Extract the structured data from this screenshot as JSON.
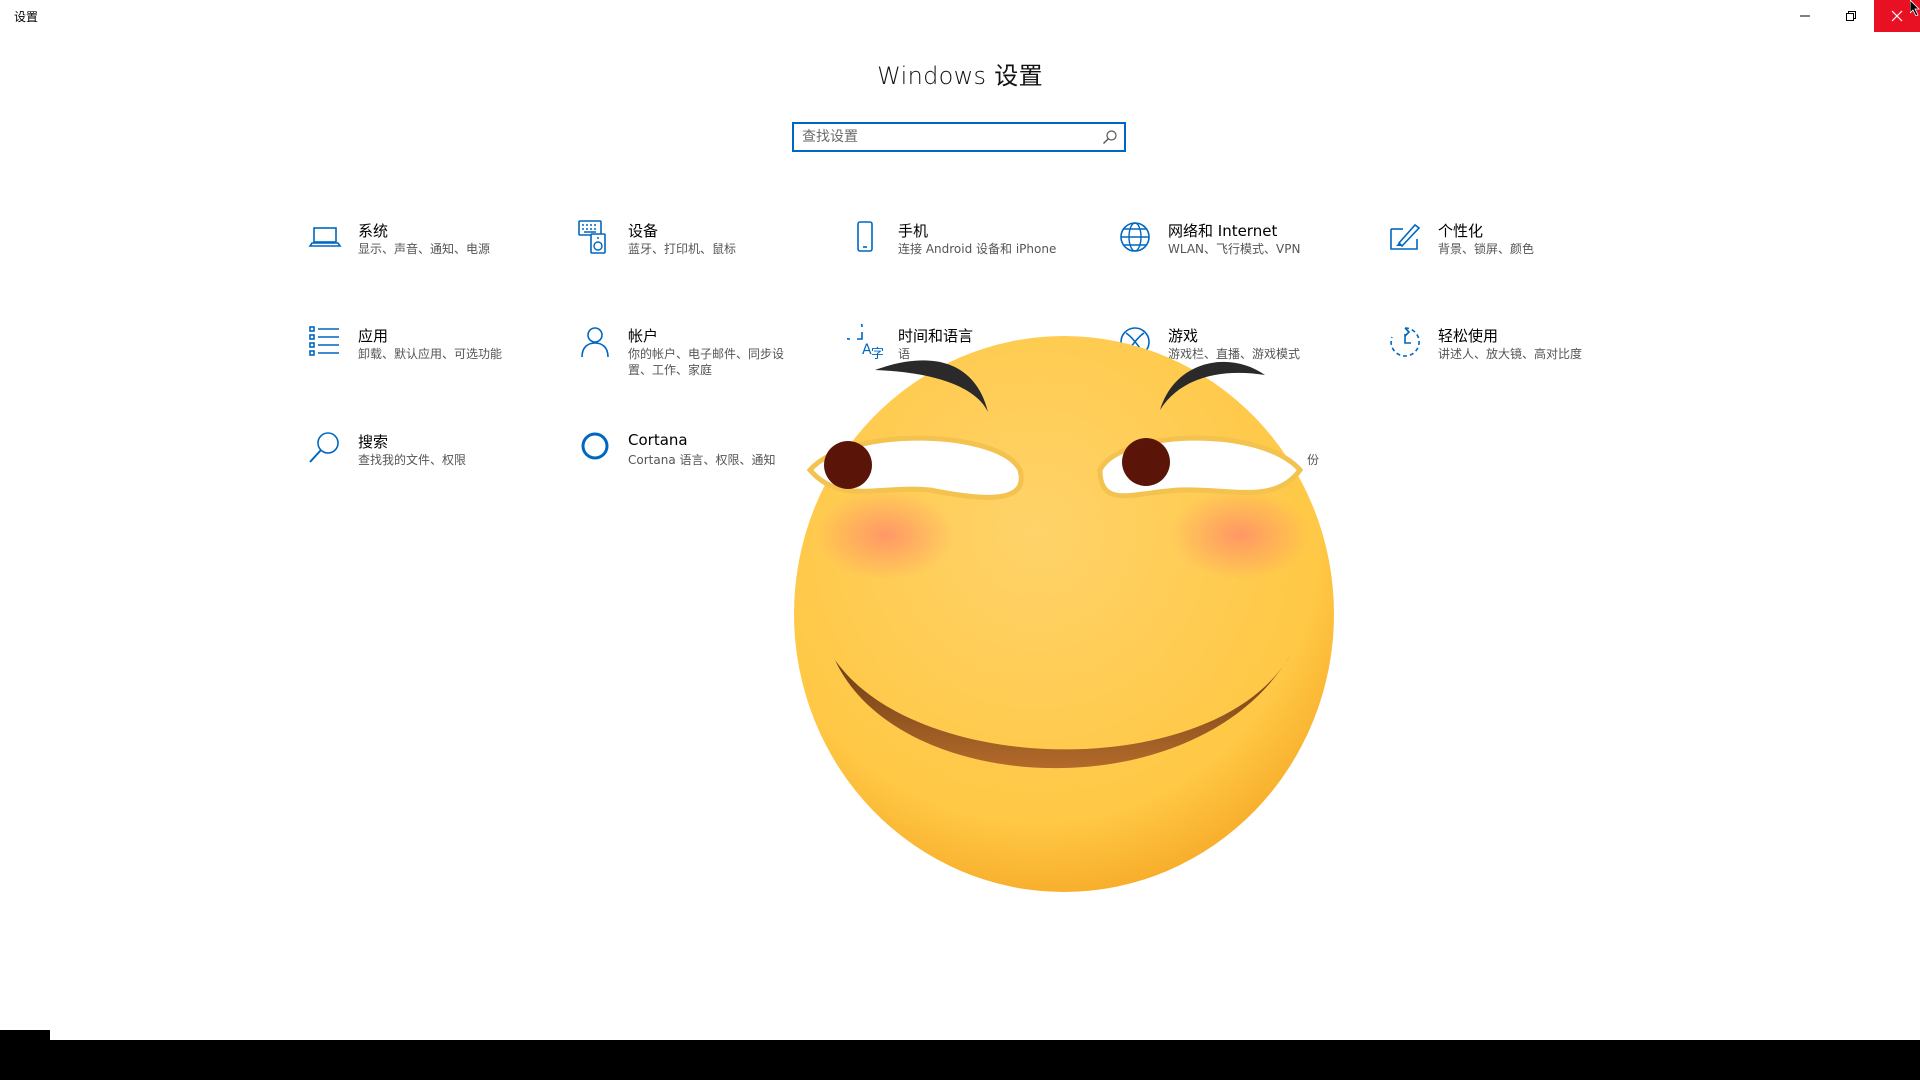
{
  "window": {
    "title": "设置"
  },
  "header": {
    "title": "Windows 设置"
  },
  "search": {
    "placeholder": "查找设置",
    "value": ""
  },
  "categories": [
    {
      "name": "系统",
      "desc": "显示、声音、通知、电源",
      "icon": "laptop-icon"
    },
    {
      "name": "设备",
      "desc": "蓝牙、打印机、鼠标",
      "icon": "devices-icon"
    },
    {
      "name": "手机",
      "desc": "连接 Android 设备和 iPhone",
      "icon": "phone-icon"
    },
    {
      "name": "网络和 Internet",
      "desc": "WLAN、飞行模式、VPN",
      "icon": "globe-icon"
    },
    {
      "name": "个性化",
      "desc": "背景、锁屏、颜色",
      "icon": "paintbrush-icon"
    },
    {
      "name": "应用",
      "desc": "卸载、默认应用、可选功能",
      "icon": "apps-list-icon"
    },
    {
      "name": "帐户",
      "desc": "你的帐户、电子邮件、同步设置、工作、家庭",
      "icon": "person-icon"
    },
    {
      "name": "时间和语言",
      "desc": "语",
      "icon": "time-language-icon"
    },
    {
      "name": "游戏",
      "desc": "游戏栏、直播、游戏模式",
      "desc_visible": "直播、游戏模式",
      "icon": "xbox-icon"
    },
    {
      "name": "轻松使用",
      "desc": "讲述人、放大镜、高对比度",
      "icon": "ease-of-access-icon"
    },
    {
      "name": "搜索",
      "desc": "查找我的文件、权限",
      "icon": "search-icon"
    },
    {
      "name": "Cortana",
      "desc": "Cortana 语言、权限、通知",
      "icon": "cortana-icon"
    },
    {
      "name": "",
      "desc": "份",
      "icon": ""
    }
  ],
  "colors": {
    "accent": "#0067c0",
    "close_bg": "#e81123",
    "emoji_face": "#ffc845"
  }
}
